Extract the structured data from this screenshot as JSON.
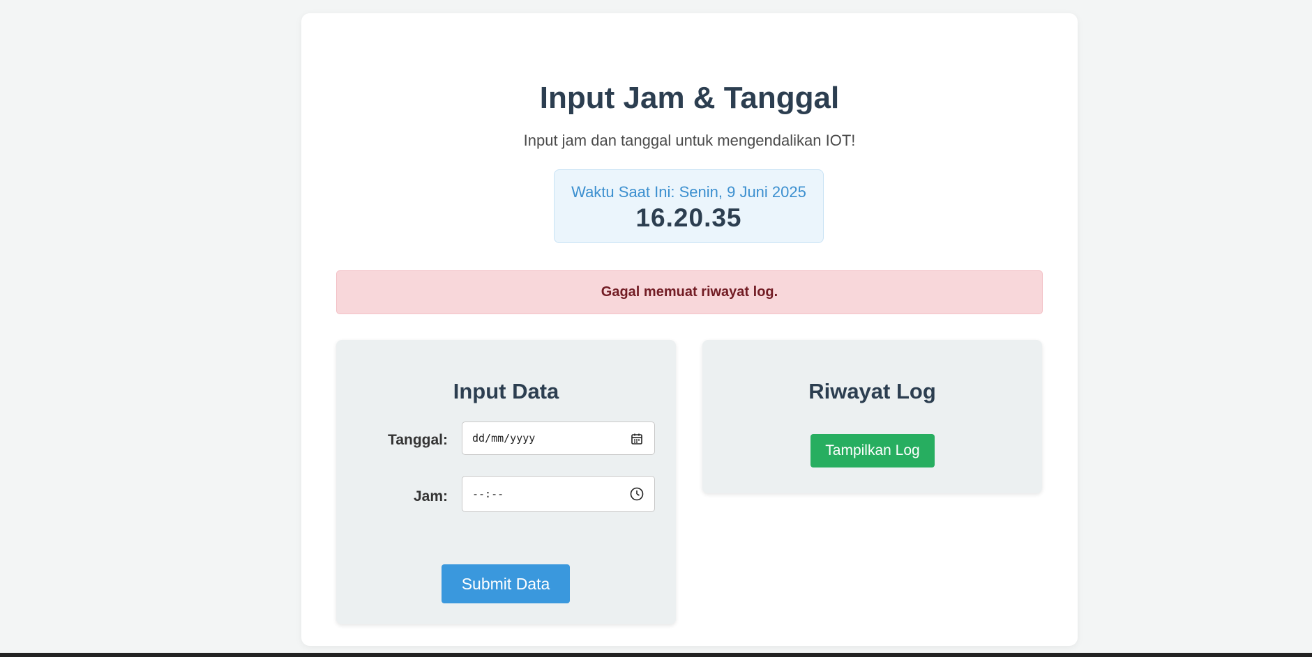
{
  "header": {
    "title": "Input Jam & Tanggal",
    "subtitle": "Input jam dan tanggal untuk mengendalikan IOT!"
  },
  "clock": {
    "label": "Waktu Saat Ini: Senin, 9 Juni 2025",
    "time": "16.20.35"
  },
  "alert": {
    "message": "Gagal memuat riwayat log."
  },
  "input_panel": {
    "title": "Input Data",
    "date_label": "Tanggal:",
    "date_placeholder": "dd/mm/yyyy",
    "time_label": "Jam:",
    "time_placeholder": "--:--",
    "submit_label": "Submit Data"
  },
  "log_panel": {
    "title": "Riwayat Log",
    "button_label": "Tampilkan Log"
  },
  "colors": {
    "title": "#2c3e50",
    "primary_button": "#3a98dd",
    "success_button": "#27ae60",
    "alert_bg": "#f8d7da",
    "alert_text": "#721c24",
    "clock_accent": "#3b8fcf"
  },
  "icons": {
    "date": "calendar-icon",
    "time": "clock-icon"
  }
}
